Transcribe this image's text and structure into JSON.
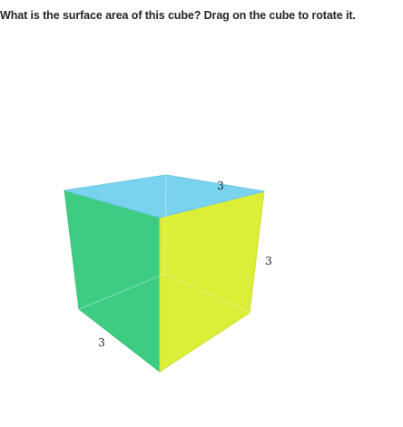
{
  "question": {
    "prompt": "What is the surface area of this cube? Drag on the cube to rotate it."
  },
  "cube": {
    "edge_labels": {
      "top_back_edge": "3",
      "right_vertical_edge": "3",
      "bottom_left_edge": "3"
    },
    "colors": {
      "top_face": "#7ad3ee",
      "left_face": "#3dcc82",
      "right_face": "#dbee38"
    }
  }
}
